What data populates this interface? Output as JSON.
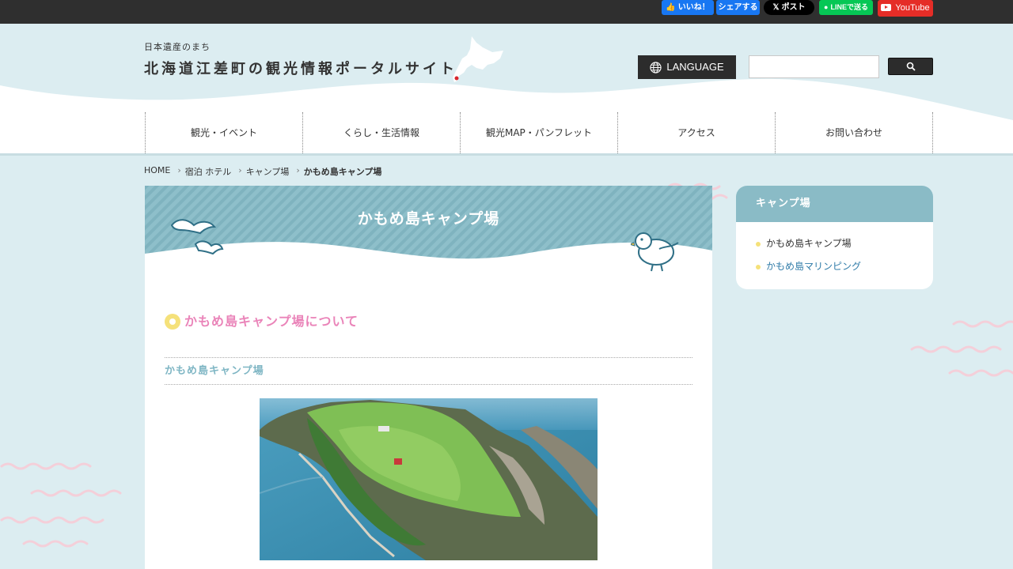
{
  "social": {
    "fb_like": "いいね！",
    "fb_share": "シェアする",
    "x_post": "ポスト",
    "line_send": "LINEで送る",
    "youtube": "YouTube"
  },
  "header": {
    "tagline": "日本遺産のまち",
    "site_title": "北海道江差町の観光情報ポータルサイト",
    "language_label": "LANGUAGE",
    "search_placeholder": ""
  },
  "nav": {
    "items": [
      {
        "label": "観光・イベント"
      },
      {
        "label": "くらし・生活情報"
      },
      {
        "label": "観光MAP・パンフレット"
      },
      {
        "label": "アクセス"
      },
      {
        "label": "お問い合わせ"
      }
    ]
  },
  "breadcrumb": {
    "items": [
      "HOME",
      "宿泊 ホテル",
      "キャンプ場"
    ],
    "current": "かもめ島キャンプ場"
  },
  "main": {
    "page_title": "かもめ島キャンプ場",
    "section_heading": "かもめ島キャンプ場について",
    "sub_heading": "かもめ島キャンプ場"
  },
  "sidebar": {
    "title": "キャンプ場",
    "items": [
      {
        "label": "かもめ島キャンプ場"
      },
      {
        "label": "かもめ島マリンピング"
      }
    ]
  },
  "colors": {
    "page_bg": "#dcedf1",
    "accent_teal": "#8abbc6",
    "title_pink": "#ea84b9",
    "marker_yellow": "#f5e17a",
    "link_blue": "#2f7ba8"
  }
}
